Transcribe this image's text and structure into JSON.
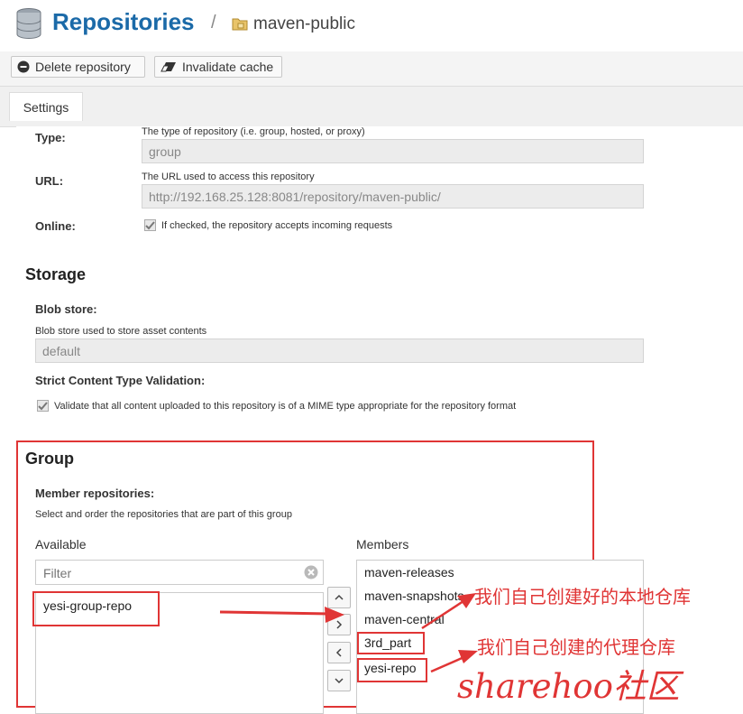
{
  "header": {
    "title": "Repositories",
    "separator": "/",
    "repo_name": "maven-public"
  },
  "toolbar": {
    "delete_label": "Delete repository",
    "invalidate_label": "Invalidate cache"
  },
  "tabs": {
    "settings": "Settings"
  },
  "settings": {
    "type_label": "Type:",
    "type_help": "The type of repository (i.e. group, hosted, or proxy)",
    "type_value": "group",
    "url_label": "URL:",
    "url_help": "The URL used to access this repository",
    "url_value": "http://192.168.25.128:8081/repository/maven-public/",
    "online_label": "Online:",
    "online_help": "If checked, the repository accepts incoming requests",
    "online_checked": true
  },
  "storage": {
    "heading": "Storage",
    "blob_label": "Blob store:",
    "blob_help": "Blob store used to store asset contents",
    "blob_value": "default",
    "strict_label": "Strict Content Type Validation:",
    "strict_help": "Validate that all content uploaded to this repository is of a MIME type appropriate for the repository format",
    "strict_checked": true
  },
  "group": {
    "heading": "Group",
    "member_label": "Member repositories:",
    "member_help": "Select and order the repositories that are part of this group",
    "available_label": "Available",
    "filter_placeholder": "Filter",
    "available_items": [
      "yesi-group-repo"
    ],
    "members_label": "Members",
    "members_items": [
      "maven-releases",
      "maven-snapshots",
      "maven-central",
      "3rd_part",
      "yesi-repo"
    ]
  },
  "annotations": {
    "local_repo": "我们自己创建好的本地仓库",
    "proxy_repo": "我们自己创建的代理仓库",
    "watermark": "sharehoo社区"
  },
  "colors": {
    "title": "#1b6aa8",
    "annotation": "#e03535"
  }
}
